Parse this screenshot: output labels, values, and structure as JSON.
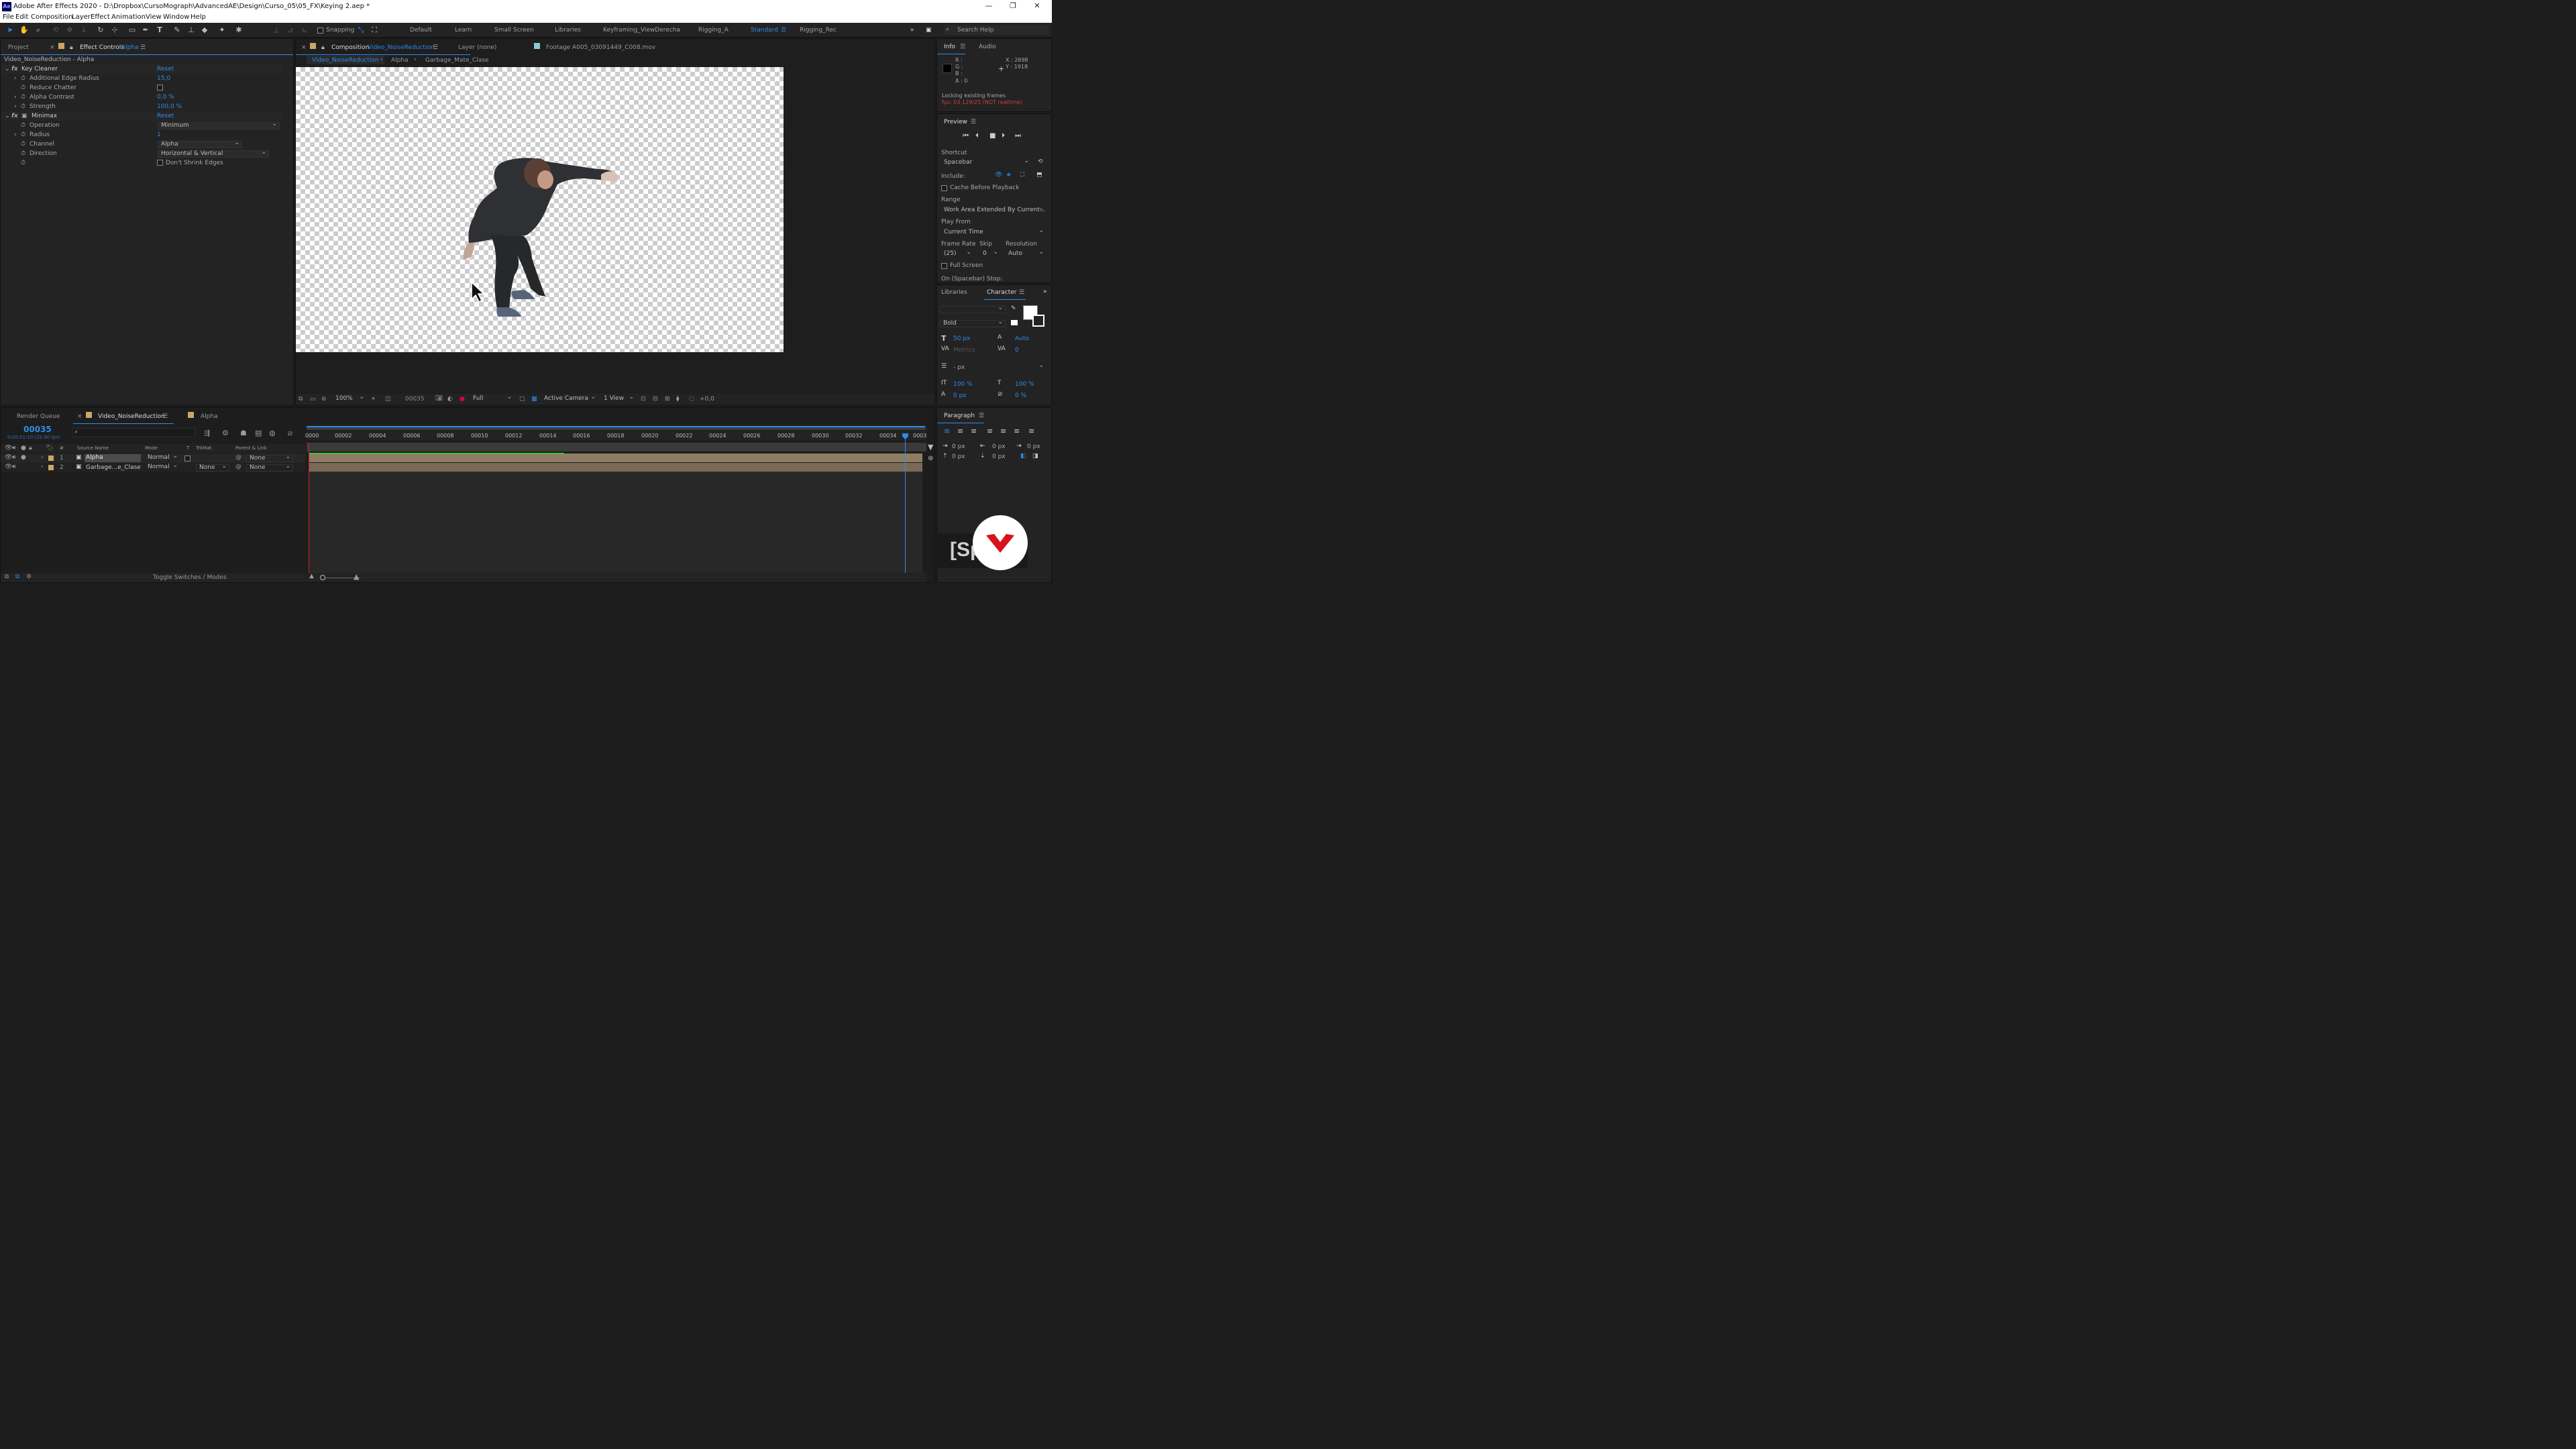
{
  "window": {
    "title": "Adobe After Effects 2020 - D:\\Dropbox\\CursoMograph\\AdvancedAE\\Design\\Curso_05\\05_FX\\Keying 2.aep *",
    "app_icon": "Ae"
  },
  "menu": [
    "File",
    "Edit",
    "Composition",
    "Layer",
    "Effect",
    "Animation",
    "View",
    "Window",
    "Help"
  ],
  "toolbar": {
    "snapping": "Snapping",
    "workspaces": [
      "Default",
      "Learn",
      "Small Screen",
      "Libraries",
      "Keyframing_ViewDerecha",
      "Rigging_A",
      "Standard",
      "Rigging_Rec"
    ],
    "active_workspace": "Standard",
    "search_placeholder": "Search Help"
  },
  "left_panel": {
    "tab_project": "Project",
    "tab_effect_controls": "Effect Controls",
    "effect_layer": "Alpha",
    "header": "Video_NoiseReduction - Alpha",
    "key_cleaner": {
      "name": "Key Cleaner",
      "reset": "Reset",
      "props": [
        {
          "label": "Additional Edge Radius",
          "value": "15,0"
        },
        {
          "label": "Reduce Chatter",
          "value": ""
        },
        {
          "label": "Alpha Contrast",
          "value": "0,0 %"
        },
        {
          "label": "Strength",
          "value": "100,0 %"
        }
      ]
    },
    "minimax": {
      "name": "Minimax",
      "reset": "Reset",
      "operation_label": "Operation",
      "operation": "Minimum",
      "radius_label": "Radius",
      "radius": "1",
      "channel_label": "Channel",
      "channel": "Alpha",
      "direction_label": "Direction",
      "direction": "Horizontal & Vertical",
      "dont_shrink": "Don't Shrink Edges"
    }
  },
  "comp_panel": {
    "tab_comp_prefix": "Composition",
    "comp_name": "Video_NoiseReduction",
    "tab_layer": "Layer  (none)",
    "tab_footage": "Footage  A005_03091449_C008.mov",
    "breadcrumbs": [
      "Video_NoiseReduction",
      "Alpha",
      "Garbage_Mate_Clase"
    ],
    "bottom": {
      "zoom": "100%",
      "timecode": "00035",
      "resolution": "Full",
      "camera": "Active Camera",
      "views": "1 View",
      "exposure": "+0,0"
    }
  },
  "right_panel": {
    "info_tab": "Info",
    "audio_tab": "Audio",
    "rgba": {
      "R": "R :",
      "G": "G :",
      "B": "B :",
      "A": "A : 0"
    },
    "coords": {
      "x": "X : 2698",
      "y": "Y : 1918"
    },
    "locking": "Locking existing frames",
    "fps": "fps: 03,129/25 (NOT realtime)",
    "preview_tab": "Preview",
    "shortcut_label": "Shortcut",
    "shortcut": "Spacebar",
    "include_label": "Include:",
    "cache": "Cache Before Playback",
    "range_label": "Range",
    "range": "Work Area Extended By Current...",
    "playfrom_label": "Play From",
    "playfrom": "Current Time",
    "framerate_label": "Frame Rate",
    "skip_label": "Skip",
    "resolution_label": "Resolution",
    "framerate": "(25)",
    "skip": "0",
    "resolution": "Auto",
    "fullscreen": "Full Screen",
    "stop": "On (Spacebar) Stop:",
    "libraries_tab": "Libraries",
    "character_tab": "Character",
    "font_style": "Bold",
    "font_size": "50 px",
    "leading": "Auto",
    "kerning": "Metrics",
    "tracking": "0",
    "stroke": "- px",
    "vscale": "100 %",
    "hscale": "100 %",
    "baseline": "0 px",
    "tsume": "0 %",
    "paragraph_tab": "Paragraph",
    "indent": [
      "0 px",
      "0 px",
      "0 px",
      "0 px",
      "0 px"
    ]
  },
  "timeline": {
    "render_queue": "Render Queue",
    "comp_tab": "Video_NoiseReduction",
    "alpha_tab": "Alpha",
    "timecode": "00035",
    "timecode_sub": "0:00:01:10 (25.00 fps)",
    "columns": {
      "num": "#",
      "source": "Source Name",
      "mode": "Mode",
      "t": "T",
      "trkmat": "TrkMat",
      "parent": "Parent & Link"
    },
    "layers": [
      {
        "num": "1",
        "name": "Alpha",
        "mode": "Normal",
        "trkmat": "",
        "parent": "None"
      },
      {
        "num": "2",
        "name": "Garbage...e_Clase",
        "mode": "Normal",
        "trkmat": "None",
        "parent": "None"
      }
    ],
    "ticks": [
      "0000",
      "00002",
      "00004",
      "00006",
      "00008",
      "00010",
      "00012",
      "00014",
      "00016",
      "00018",
      "00020",
      "00022",
      "00024",
      "00026",
      "00028",
      "00030",
      "00032",
      "00034",
      "0003"
    ],
    "toggle": "Toggle Switches / Modes"
  },
  "overlay": {
    "text": "[Sp"
  },
  "colors": {
    "accent": "#2d8ceb",
    "bg": "#1d1d1d",
    "panel": "#232323",
    "layer_bar": "#8e7d64",
    "fps_warn": "#d23b3b",
    "logo_red": "#d8121a"
  }
}
